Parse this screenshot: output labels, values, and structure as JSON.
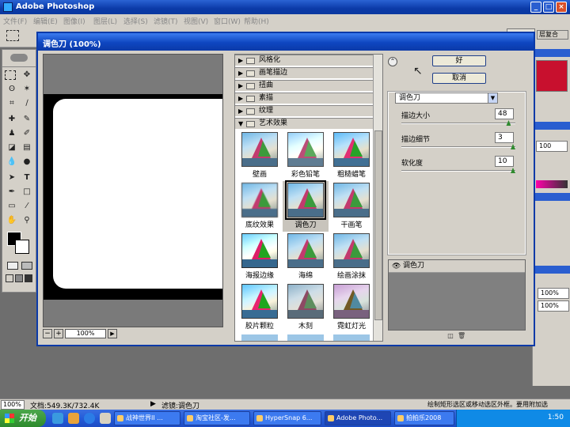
{
  "app": {
    "title": "Adobe Photoshop"
  },
  "menu": [
    "文件(F)",
    "编辑(E)",
    "图像(I)",
    "图层(L)",
    "选择(S)",
    "滤镜(T)",
    "视图(V)",
    "窗口(W)",
    "帮助(H)"
  ],
  "options_bar": {
    "tab_label": "层复合"
  },
  "right_panels": {
    "zoom_field": "100",
    "opacity_1": "100%",
    "opacity_2": "100%"
  },
  "dialog": {
    "title": "调色刀 (100%)",
    "preview": {
      "zoom": "100%",
      "minus": "−",
      "plus": "+"
    },
    "categories_top": [
      "风格化",
      "画笔描边",
      "扭曲",
      "素描",
      "纹理"
    ],
    "category_open": "艺术效果",
    "filters": [
      {
        "label": "壁画",
        "selected": false
      },
      {
        "label": "彩色铅笔",
        "selected": false
      },
      {
        "label": "粗糙蜡笔",
        "selected": false
      },
      {
        "label": "底纹效果",
        "selected": false
      },
      {
        "label": "调色刀",
        "selected": true
      },
      {
        "label": "干画笔",
        "selected": false
      },
      {
        "label": "海报边缘",
        "selected": false
      },
      {
        "label": "海绵",
        "selected": false
      },
      {
        "label": "绘画涂抹",
        "selected": false
      },
      {
        "label": "胶片颗粒",
        "selected": false
      },
      {
        "label": "木刻",
        "selected": false
      },
      {
        "label": "霓虹灯光",
        "selected": false
      }
    ],
    "ok_label": "好",
    "cancel_label": "取消",
    "filter_select": "调色刀",
    "params": [
      {
        "label": "描边大小",
        "value": "48",
        "fraction": 0.96
      },
      {
        "label": "描边细节",
        "value": "3",
        "fraction": 1.0
      },
      {
        "label": "软化度",
        "value": "10",
        "fraction": 1.0
      }
    ],
    "layer_name": "调色刀"
  },
  "status": {
    "zoom": "100%",
    "doc": "文档:549.3K/732.4K",
    "filter": "滤镜:调色刀",
    "hint": "绘制矩形选区或移动选区外框。要用附加选"
  },
  "taskbar": {
    "start": "开始",
    "tasks": [
      "战神世界II ...",
      "淘宝社区-发...",
      "HyperSnap 6...",
      "Adobe Photo...",
      "拍拍乐2008"
    ],
    "clock": "1:50"
  }
}
